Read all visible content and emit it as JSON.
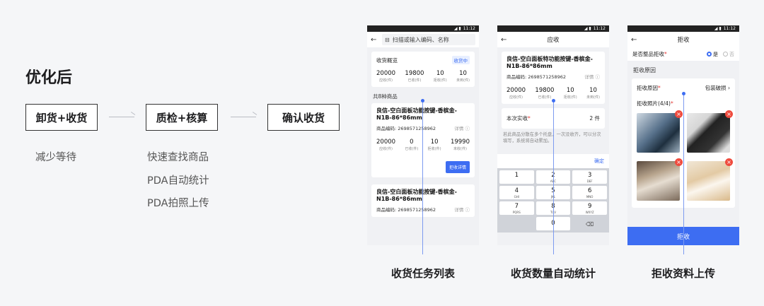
{
  "left": {
    "title": "优化后",
    "flow": [
      "卸货+收货",
      "质检+核算",
      "确认收货"
    ],
    "notes": [
      "减少等待",
      "快速查找商品",
      "PDA自动统计",
      "PDA拍照上传"
    ]
  },
  "statusbar_time": "11:12",
  "phone1": {
    "search_placeholder": "扫描或输入编码、名称",
    "overview_title": "收货概览",
    "overview_tag": "收货中",
    "overview_stats": [
      {
        "v": "20000",
        "l": "应收(件)"
      },
      {
        "v": "19800",
        "l": "已收(件)"
      },
      {
        "v": "10",
        "l": "拒收(件)"
      },
      {
        "v": "10",
        "l": "未到(件)"
      }
    ],
    "count_label": "共8种商品",
    "product1": {
      "name": "良信-空白面板功能按键-香槟金-N1B-86*86mm",
      "code": "商品编码: 2698571258962",
      "detail": "详情",
      "stats": [
        {
          "v": "20000",
          "l": "应收(件)"
        },
        {
          "v": "0",
          "l": "已收(件)"
        },
        {
          "v": "10",
          "l": "拒收(件)"
        },
        {
          "v": "19990",
          "l": "未收(件)"
        }
      ],
      "button": "拒收详情"
    },
    "product2": {
      "name": "良信-空白面板功能按键-香槟金-N1B-86*86mm",
      "code": "商品编码: 2698571258962",
      "detail": "详情"
    }
  },
  "phone2": {
    "title": "应收",
    "product": {
      "name": "良信-空白面板特功能按键-香槟金-N1B-86*86mm",
      "code": "商品编码: 2698571258962",
      "detail": "详情",
      "stats": [
        {
          "v": "20000",
          "l": "应收(件)"
        },
        {
          "v": "19800",
          "l": "已收(件)"
        },
        {
          "v": "10",
          "l": "拒收(件)"
        },
        {
          "v": "10",
          "l": "未到(件)"
        }
      ]
    },
    "actual_label": "本次实收",
    "actual_value": "2 件",
    "hint": "若此商品分散在多个托盘，一次没收齐，可以分次填写，系统将自动累加。",
    "confirm": "确定",
    "keys": [
      {
        "k": "1",
        "s": ""
      },
      {
        "k": "2",
        "s": "ABC"
      },
      {
        "k": "3",
        "s": "DEF"
      },
      {
        "k": "4",
        "s": "GHI"
      },
      {
        "k": "5",
        "s": "JKL"
      },
      {
        "k": "6",
        "s": "MNO"
      },
      {
        "k": "7",
        "s": "PQRS"
      },
      {
        "k": "8",
        "s": "TUV"
      },
      {
        "k": "9",
        "s": "WXYZ"
      }
    ],
    "zero": "0",
    "del": "⌫"
  },
  "phone3": {
    "title": "拒收",
    "whole_label": "是否整品拒收",
    "yes": "是",
    "no": "否",
    "reason_section": "拒收原因",
    "reason_label": "拒收原因",
    "reason_value": "包装破损",
    "photo_label": "拒收照片(4/4)",
    "button": "拒收"
  },
  "captions": [
    "收货任务列表",
    "收货数量自动统计",
    "拒收资料上传"
  ]
}
